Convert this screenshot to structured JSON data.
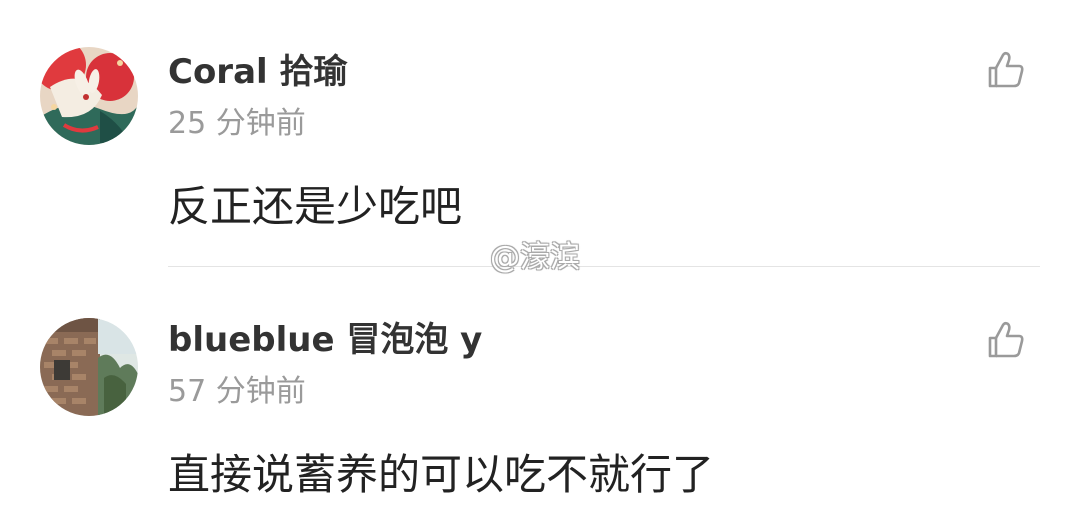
{
  "comments": [
    {
      "username": "Coral 拾瑜",
      "time": "25 分钟前",
      "text": "反正还是少吃吧",
      "like_icon": "thumbs-up-outline-icon"
    },
    {
      "username": "blueblue 冒泡泡 y",
      "time": "57 分钟前",
      "text": "直接说蓄养的可以吃不就行了",
      "like_icon": "thumbs-up-outline-icon"
    }
  ],
  "watermark": "@濠滨",
  "colors": {
    "username": "#333333",
    "timestamp": "#9a9a9a",
    "body_text": "#222222",
    "divider": "#e4e4e4",
    "icon_stroke": "#9a9a9a"
  }
}
